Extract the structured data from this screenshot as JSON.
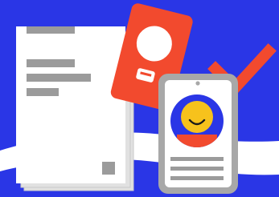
{
  "colors": {
    "background": "#2a36e6",
    "swoosh": "#ffffff",
    "paper": "#ffffff",
    "paper_shadow": "#e1e1e1",
    "paper_lines": "#9b9b9b",
    "passport": "#f24a2e",
    "badge_frame": "#a8a8a8",
    "badge_body": "#ffffff",
    "badge_avatar_bg": "#2a36e6",
    "badge_face": "#f7c21c",
    "badge_shirt": "#f24a2e",
    "badge_lines": "#9b9b9b",
    "checkmark": "#f24a2e"
  },
  "icons": {
    "document": "document-icon",
    "passport": "passport-icon",
    "id_badge": "id-badge-icon",
    "checkmark": "checkmark-icon"
  }
}
